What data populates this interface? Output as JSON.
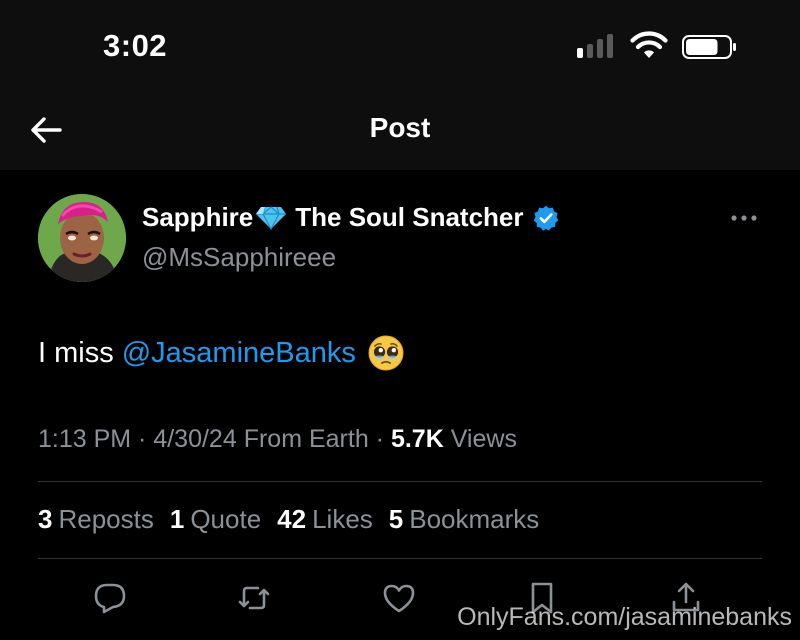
{
  "status_bar": {
    "time": "3:02",
    "signal_bars_active": 1,
    "signal_bars_total": 4,
    "wifi_icon": "wifi-icon",
    "battery_icon": "battery-icon",
    "battery_level": 0.75
  },
  "nav": {
    "back_icon": "arrow-left-icon",
    "title": "Post"
  },
  "author": {
    "display_name_part1": "Sapphire",
    "display_name_emoji": "gem-icon",
    "display_name_part2": "The Soul Snatcher",
    "verified_icon": "verified-badge-icon",
    "handle": "@MsSapphireee",
    "more_icon": "more-horizontal-icon"
  },
  "tweet": {
    "text_prefix": "I miss",
    "mention": "@JasamineBanks",
    "emoji": "pleading-face-emoji"
  },
  "meta": {
    "time": "1:13 PM",
    "sep1": " · ",
    "date": "4/30/24",
    "source": " From Earth",
    "sep2": " · ",
    "views_count": "5.7K",
    "views_label": " Views"
  },
  "stats": [
    {
      "count": "3",
      "label": "Reposts"
    },
    {
      "count": "1",
      "label": "Quote"
    },
    {
      "count": "42",
      "label": "Likes"
    },
    {
      "count": "5",
      "label": "Bookmarks"
    }
  ],
  "actions": [
    "reply-icon",
    "repost-icon",
    "like-icon",
    "bookmark-icon",
    "share-icon"
  ],
  "watermark": "OnlyFans.com/jasaminebanks",
  "colors": {
    "background": "#000000",
    "link": "#1d9bf0",
    "secondary_text": "#8b9197",
    "divider": "#2f3336"
  }
}
